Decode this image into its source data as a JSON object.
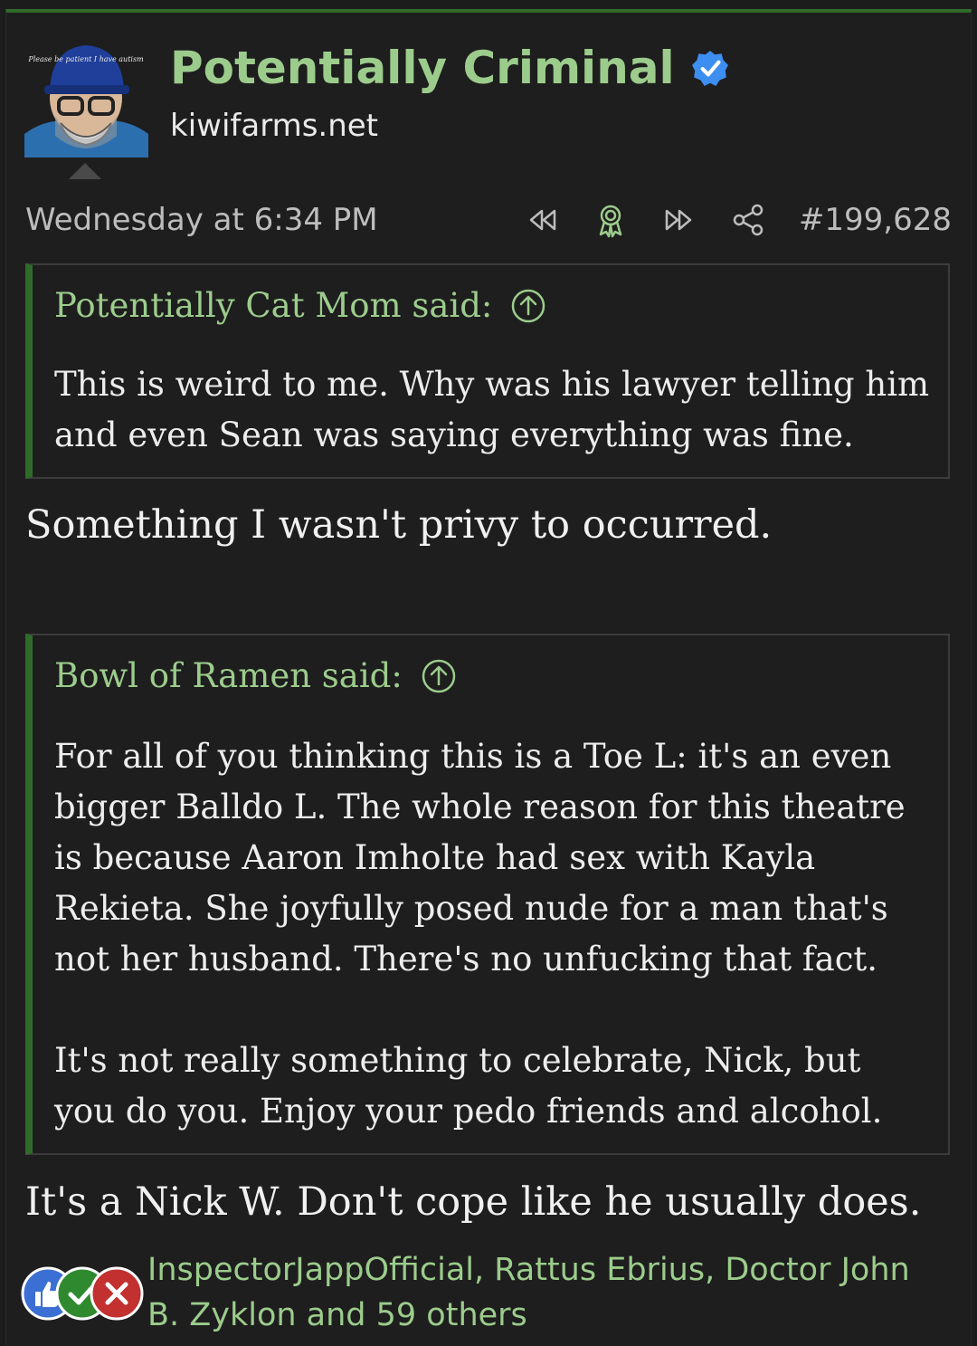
{
  "post": {
    "username": "Potentially Criminal",
    "site": "kiwifarms.net",
    "date": "Wednesday at 6:34 PM",
    "number": "#199,628",
    "avatar_text": "Please be patient I have autism"
  },
  "quotes": [
    {
      "author": "Potentially Cat Mom said:",
      "paragraphs": [
        "This is weird to me. Why was his lawyer telling him and even Sean was saying everything was fine."
      ]
    },
    {
      "author": "Bowl of Ramen said:",
      "paragraphs": [
        "For all of you thinking this is a Toe L: it's an even bigger Balldo L. The whole reason for this theatre is because Aaron Imholte had sex with Kayla Rekieta. She joyfully posed nude for a man that's not her husband. There's no unfucking that fact.",
        "It's not really something to celebrate, Nick, but you do you. Enjoy your pedo friends and alcohol."
      ]
    }
  ],
  "replies": [
    "Something I wasn't privy to occurred.",
    "It's a Nick W. Don't cope like he usually does."
  ],
  "reactions": {
    "icons": [
      "thumbs-up-icon",
      "check-icon",
      "x-icon"
    ],
    "colors": [
      "#3b6fd4",
      "#2f8a2f",
      "#c23030"
    ],
    "users_text": "InspectorJappOfficial, Rattus Ebrius, Doctor John B. Zyklon and 59 others"
  },
  "colors": {
    "accent": "#2f6b2a",
    "username": "#9ccc8c",
    "verified": "#3c8ef0"
  }
}
